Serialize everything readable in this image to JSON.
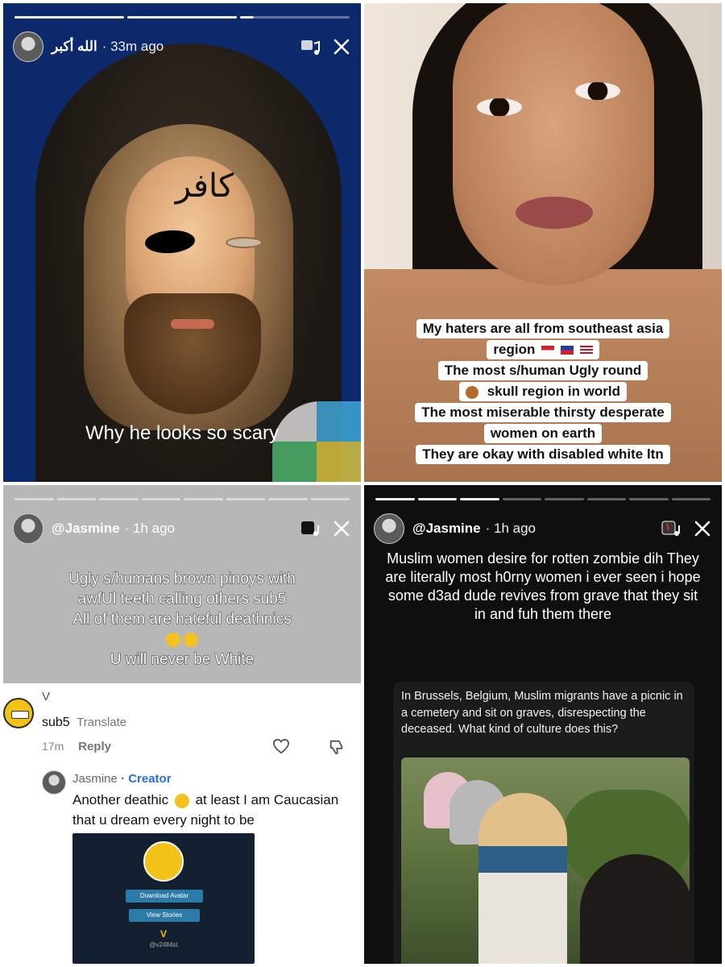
{
  "panels": {
    "top_left": {
      "progress": {
        "segments": 3,
        "complete": 2,
        "current_fraction": 0.12
      },
      "header": {
        "username": "الله أكبر",
        "time": "· 33m ago"
      },
      "overlay_text": "كافر",
      "caption": "Why he looks so scary"
    },
    "top_right": {
      "captions": [
        "My haters are all from southeast asia",
        "region",
        "The most s/human Ugly round",
        "skull region in world",
        "The most miserable thirsty desperate",
        "women on earth",
        "They are okay with disabled white ltn"
      ]
    },
    "bottom_left": {
      "progress": {
        "segments": 8,
        "complete": 3
      },
      "header": {
        "username": "@Jasmine",
        "time": "· 1h ago"
      },
      "story_lines": [
        "Ugly s/humans brown pinoys with",
        "awfUl teeth calling others sub5",
        "All of them are hateful deathnics",
        "U will never be White"
      ],
      "comment": {
        "user": "V",
        "text": "sub5",
        "translate": "Translate",
        "time": "17m",
        "reply_label": "Reply"
      },
      "reply": {
        "user": "Jasmine",
        "badge": "· Creator",
        "text_before": "Another deathic",
        "text_after": "at least I am Caucasian that u dream every night to be"
      },
      "mini_profile": {
        "download_label": "Download Avatar",
        "stories_label": "View Stories",
        "name": "V",
        "handle": "@v24ll4st"
      }
    },
    "bottom_right": {
      "progress": {
        "segments": 8,
        "complete": 3
      },
      "header": {
        "username": "@Jasmine",
        "time": "· 1h ago"
      },
      "story_text": "Muslim women desire for rotten zombie dih They are literally most h0rny women i ever seen i hope some d3ad dude revives from grave that they sit in and fuh them there",
      "tweet_text": "In Brussels, Belgium, Muslim migrants have a picnic in a cemetery and sit on graves, disrespecting the deceased. What kind of culture does this?"
    }
  },
  "colors": {
    "creator_blue": "#2a6de0",
    "story_grey": "#b7b7b7",
    "dark_bg": "#0f0f10"
  }
}
